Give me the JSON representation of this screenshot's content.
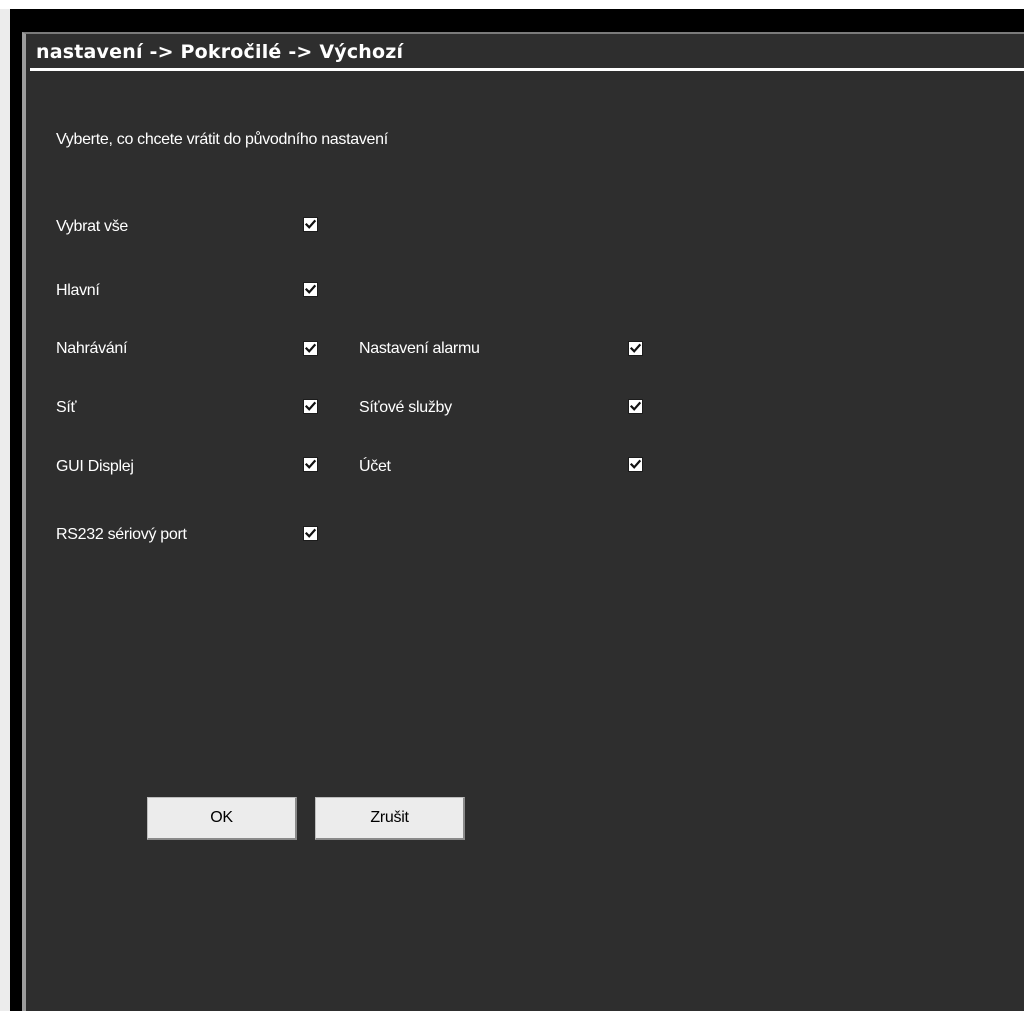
{
  "title": "nastavení -> Pokročilé -> Výchozí",
  "instruction": "Vyberte, co chcete vrátit do původního nastavení",
  "options": {
    "select_all": {
      "label": "Vybrat vše",
      "checked": true
    },
    "main": {
      "label": "Hlavní",
      "checked": true
    },
    "recording": {
      "label": "Nahrávání",
      "checked": true
    },
    "alarm_settings": {
      "label": "Nastavení alarmu",
      "checked": true
    },
    "network": {
      "label": "Síť",
      "checked": true
    },
    "network_services": {
      "label": "Síťové služby",
      "checked": true
    },
    "gui_display": {
      "label": "GUI Displej",
      "checked": true
    },
    "account": {
      "label": "Účet",
      "checked": true
    },
    "rs232": {
      "label": "RS232 sériový port",
      "checked": true
    }
  },
  "buttons": {
    "ok": "OK",
    "cancel": "Zrušit"
  },
  "colors": {
    "panel_bg": "#2e2e2e",
    "window_bg": "#000000",
    "text": "#ffffff",
    "button_bg": "#ececec"
  }
}
